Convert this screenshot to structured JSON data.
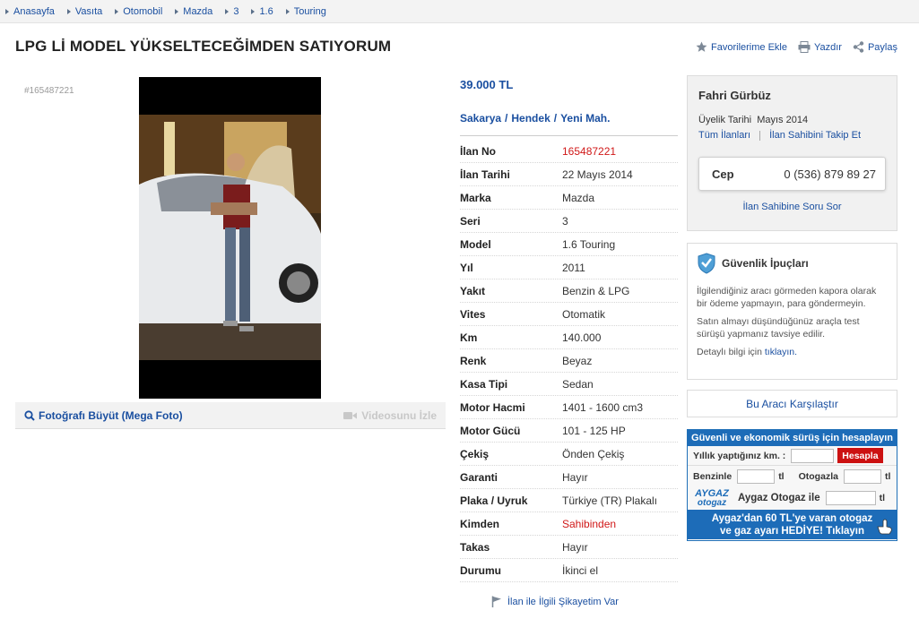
{
  "breadcrumb": [
    "Anasayfa",
    "Vasıta",
    "Otomobil",
    "Mazda",
    "3",
    "1.6",
    "Touring"
  ],
  "title": "LPG Lİ MODEL YÜKSELTECEĞİMDEN SATIYORUM",
  "actions": {
    "favorite": "Favorilerime Ekle",
    "print": "Yazdır",
    "share": "Paylaş"
  },
  "photo": {
    "listing_id": "#165487221",
    "mega": "Fotoğrafı Büyüt (Mega Foto)",
    "video": "Videosunu İzle"
  },
  "price": "39.000 TL",
  "location": {
    "city": "Sakarya",
    "district": "Hendek",
    "neighborhood": "Yeni Mah.",
    "separator": "/"
  },
  "details": [
    {
      "label": "İlan No",
      "value": "165487221",
      "color": "#d01818"
    },
    {
      "label": "İlan Tarihi",
      "value": "22 Mayıs 2014"
    },
    {
      "label": "Marka",
      "value": "Mazda"
    },
    {
      "label": "Seri",
      "value": "3"
    },
    {
      "label": "Model",
      "value": "1.6 Touring"
    },
    {
      "label": "Yıl",
      "value": "2011"
    },
    {
      "label": "Yakıt",
      "value": "Benzin & LPG"
    },
    {
      "label": "Vites",
      "value": "Otomatik"
    },
    {
      "label": "Km",
      "value": "140.000"
    },
    {
      "label": "Renk",
      "value": "Beyaz"
    },
    {
      "label": "Kasa Tipi",
      "value": "Sedan"
    },
    {
      "label": "Motor Hacmi",
      "value": "1401 - 1600 cm3"
    },
    {
      "label": "Motor Gücü",
      "value": "101 - 125 HP"
    },
    {
      "label": "Çekiş",
      "value": "Önden Çekiş"
    },
    {
      "label": "Garanti",
      "value": "Hayır"
    },
    {
      "label": "Plaka / Uyruk",
      "value": "Türkiye (TR) Plakalı"
    },
    {
      "label": "Kimden",
      "value": "Sahibinden",
      "color": "#d01818"
    },
    {
      "label": "Takas",
      "value": "Hayır"
    },
    {
      "label": "Durumu",
      "value": "İkinci el"
    }
  ],
  "complaint": "İlan ile İlgili Şikayetim Var",
  "seller": {
    "name": "Fahri Gürbüz",
    "member_label": "Üyelik Tarihi",
    "member_since": "Mayıs 2014",
    "all_listings": "Tüm İlanları",
    "follow": "İlan Sahibini Takip Et",
    "phone_label": "Cep",
    "phone": "0 (536) 879 89 27",
    "ask": "İlan Sahibine Soru Sor"
  },
  "safety": {
    "title": "Güvenlik İpuçları",
    "tip1": "İlgilendiğiniz aracı görmeden kapora olarak bir ödeme yapmayın, para göndermeyin.",
    "tip2": "Satın almayı düşündüğünüz araçla test sürüşü yapmanız tavsiye edilir.",
    "more_prefix": "Detaylı bilgi için",
    "more_link": "tıklayın."
  },
  "compare": "Bu Aracı Karşılaştır",
  "aygaz": {
    "header": "Güvenli ve ekonomik sürüş için hesaplayın",
    "yearly_km": "Yıllık yaptığınız km. :",
    "calc": "Hesapla",
    "benzin": "Benzinle",
    "otogaz": "Otogazla",
    "currency": "tl",
    "logo_top": "AYGAZ",
    "logo_bottom": "otogaz",
    "aygaz_otogaz": "Aygaz Otogaz ile",
    "promo_line1": "Aygaz'dan 60 TL'ye varan otogaz",
    "promo_line2": "ve gaz ayarı HEDİYE! Tıklayın"
  },
  "colors": {
    "link": "#1a4fa0",
    "accent_red": "#d01818",
    "aygaz_blue": "#1d6cb8"
  }
}
